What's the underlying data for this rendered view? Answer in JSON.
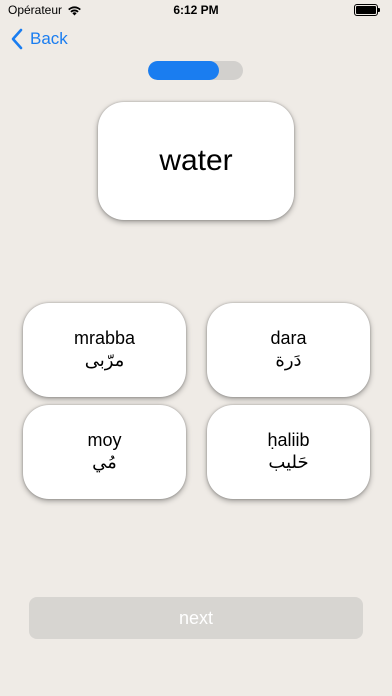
{
  "status_bar": {
    "carrier": "Opérateur",
    "time": "6:12 PM"
  },
  "nav": {
    "back_label": "Back"
  },
  "progress": {
    "fraction": 0.75
  },
  "question": {
    "word": "water"
  },
  "options": [
    {
      "latin": "mrabba",
      "arabic": "مرّبى"
    },
    {
      "latin": "dara",
      "arabic": "دَرة"
    },
    {
      "latin": "moy",
      "arabic": "مُي"
    },
    {
      "latin": "ḥaliib",
      "arabic": "حَليب"
    }
  ],
  "footer": {
    "next_label": "next"
  },
  "colors": {
    "accent": "#1a7df0",
    "background": "#efebe6",
    "next_disabled": "#d7d5d1"
  }
}
